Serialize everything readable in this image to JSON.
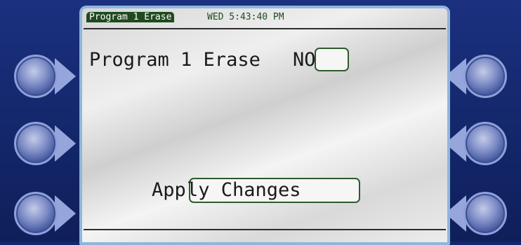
{
  "header": {
    "screen_title": "Program 1 Erase",
    "clock": "WED 5:43:40 PM"
  },
  "main": {
    "erase_label": "Program 1 Erase",
    "erase_value": "NO",
    "apply_label": "App",
    "apply_value": "ly Changes"
  },
  "side_buttons": {
    "left": [
      "left-button-1",
      "left-button-2",
      "left-button-3"
    ],
    "right": [
      "right-button-1",
      "right-button-2",
      "right-button-3"
    ]
  },
  "colors": {
    "panel": "#13266e",
    "screen": "#e8e8e8",
    "accent": "#1f4a1f",
    "bezel": "#8fb6dc"
  }
}
